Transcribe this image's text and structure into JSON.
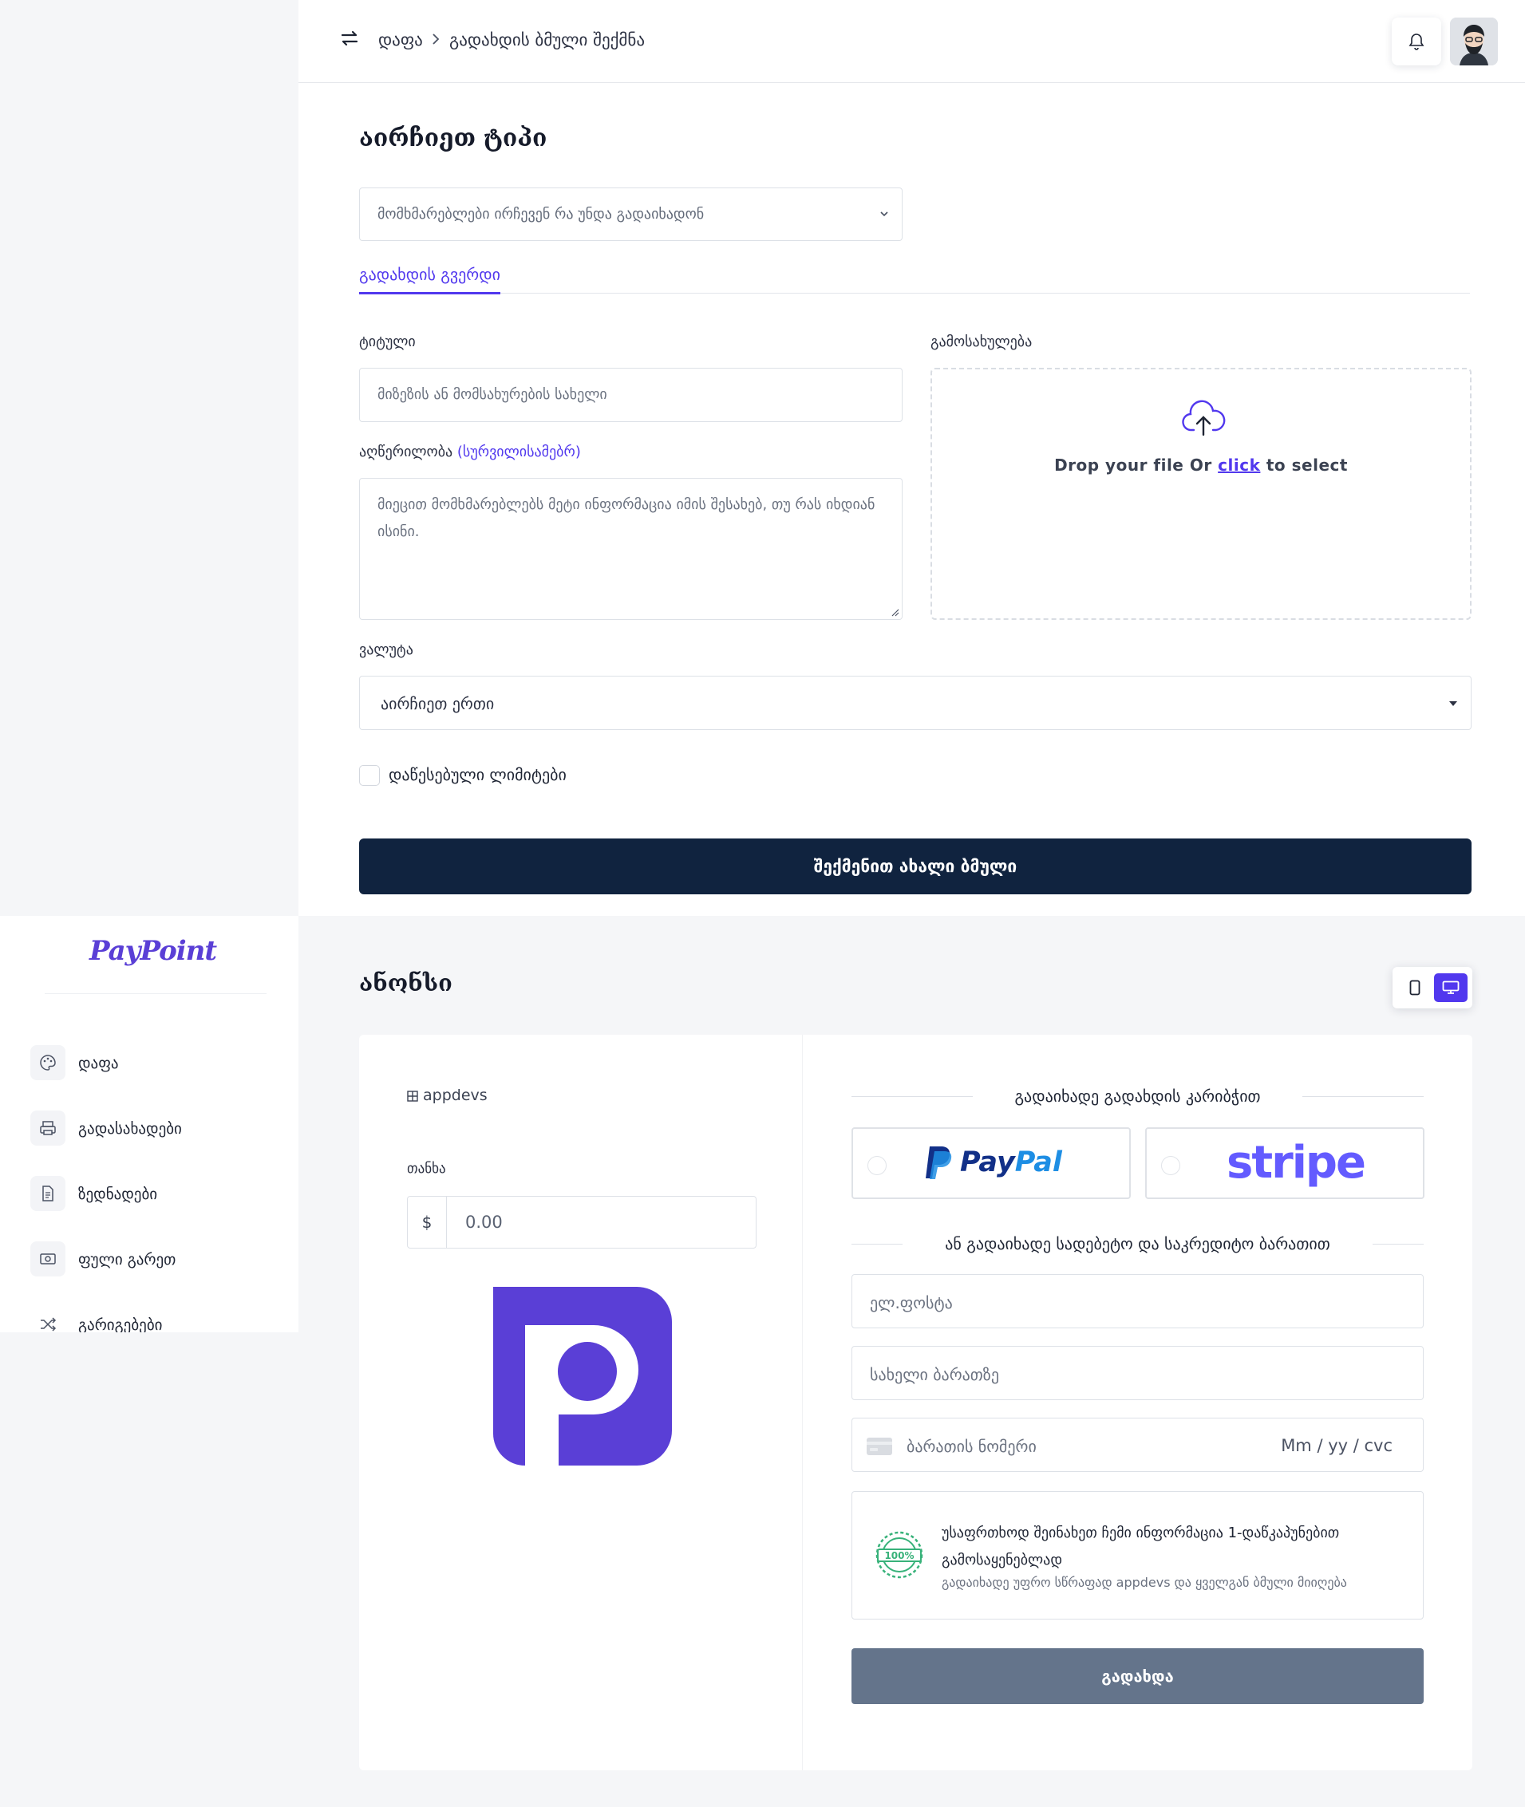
{
  "breadcrumb": {
    "home": "დაფა",
    "current": "გადახდის ბმული შექმნა"
  },
  "form": {
    "title": "აირჩიეთ ტიპი",
    "type_select_value": "მომხმარებლები ირჩევენ რა უნდა გადაიხადონ",
    "tab_label": "გადახდის გვერდი",
    "title_label": "ტიტული",
    "title_placeholder": "მიზეზის ან მომსახურების სახელი",
    "description_label": "აღწერილობა",
    "description_optional": "(სურვილისამებრ)",
    "description_placeholder": "მიეცით მომხმარებლებს მეტი ინფორმაცია იმის შესახებ, თუ რას იხდიან ისინი.",
    "image_label": "გამოსახულება",
    "dropzone_pre": "Drop your file Or ",
    "dropzone_link": "click",
    "dropzone_post": " to select",
    "currency_label": "ვალუტა",
    "currency_value": "აირჩიეთ ერთი",
    "limits_label": "დაწესებული ლიმიტები",
    "submit_label": "შექმენით ახალი ბმული"
  },
  "sidebar": {
    "logo_text": "PayPoint",
    "items": [
      {
        "label": "დაფა",
        "icon": "palette-icon"
      },
      {
        "label": "გადასახადები",
        "icon": "printer-icon"
      },
      {
        "label": "ზედნადები",
        "icon": "document-icon"
      },
      {
        "label": "ფული გარეთ",
        "icon": "cash-icon"
      },
      {
        "label": "გარიგებები",
        "icon": "shuffle-icon"
      }
    ]
  },
  "preview": {
    "title": "ანონსი",
    "merchant": "appdevs",
    "amount_label": "თანხა",
    "currency_symbol": "$",
    "amount_value": "0.00",
    "gateway_heading": "გადაიხადე გადახდის კარიბჭით",
    "provider_1": "PayPal",
    "provider_2": "stripe",
    "card_heading": "ან გადაიხადე სადებეტო და საკრედიტო ბარათით",
    "email_placeholder": "ელ.ფოსტა",
    "name_placeholder": "სახელი ბარათზე",
    "card_placeholder": "ბარათის ნომერი",
    "card_extra": "Mm / yy / cvc",
    "secure_title": "უსაფრთხოდ შეინახეთ ჩემი ინფორმაცია 1-დაწკაპუნებით გამოსაყენებლად",
    "secure_sub": "გადაიხადე უფრო სწრაფად appdevs და ყველგან ბმული მიიღება",
    "seal_text": "100%",
    "pay_button": "გადახდა"
  },
  "colors": {
    "accent": "#5138ee",
    "navy": "#10233f",
    "pay_button": "#64748b",
    "logo_purple": "#5a3fd6"
  }
}
